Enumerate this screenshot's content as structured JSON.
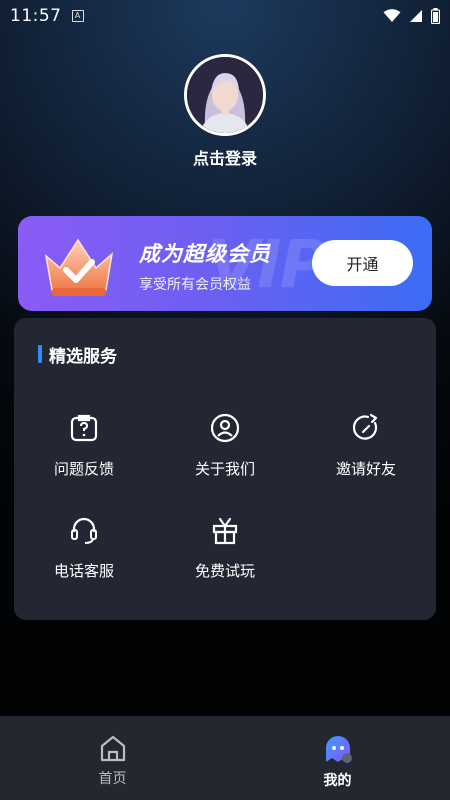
{
  "status_bar": {
    "time": "11:57",
    "notification_icon": "A"
  },
  "profile": {
    "avatar": "user-avatar",
    "login_label": "点击登录"
  },
  "vip": {
    "watermark": "VIP",
    "title": "成为超级会员",
    "subtitle": "享受所有会员权益",
    "button_label": "开通",
    "gradient_start": "#8b5cf6",
    "gradient_end": "#3b6cf5"
  },
  "services": {
    "title": "精选服务",
    "accent": "#2f8bff",
    "items": [
      {
        "label": "问题反馈",
        "icon": "feedback-icon"
      },
      {
        "label": "关于我们",
        "icon": "about-icon"
      },
      {
        "label": "邀请好友",
        "icon": "invite-icon"
      },
      {
        "label": "电话客服",
        "icon": "headset-icon"
      },
      {
        "label": "免费试玩",
        "icon": "gift-icon"
      }
    ]
  },
  "tabs": [
    {
      "label": "首页",
      "icon": "home-icon",
      "active": false
    },
    {
      "label": "我的",
      "icon": "profile-icon",
      "active": true
    }
  ]
}
